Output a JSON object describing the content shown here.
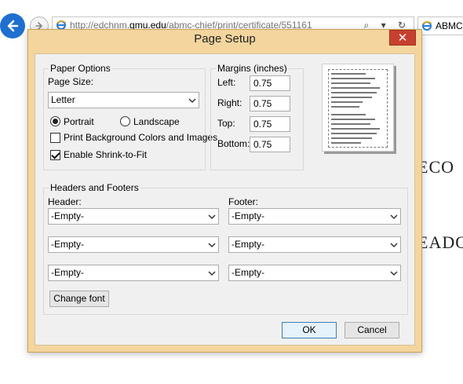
{
  "browser": {
    "url_prefix": "http://edchnm.",
    "url_host": "gmu.edu",
    "url_path": "/abmc-chief/print/certificate/551161",
    "address_actions": "⌕ ▾ ↻",
    "tab_title": "ABMC",
    "page_text_1": "ECO",
    "page_text_2": "EADO"
  },
  "dialog": {
    "title": "Page Setup",
    "close_glyph": "✕",
    "paper_options": {
      "legend": "Paper Options",
      "page_size_label": "Page Size:",
      "page_size_value": "Letter",
      "portrait_label": "Portrait",
      "landscape_label": "Landscape",
      "orientation": "Portrait",
      "print_background_label": "Print Background Colors and Images",
      "print_background_checked": false,
      "shrink_label": "Enable Shrink-to-Fit",
      "shrink_checked": true
    },
    "margins": {
      "legend": "Margins (inches)",
      "left_label": "Left:",
      "left_value": "0.75",
      "right_label": "Right:",
      "right_value": "0.75",
      "top_label": "Top:",
      "top_value": "0.75",
      "bottom_label": "Bottom:",
      "bottom_value": "0.75"
    },
    "headers_footers": {
      "legend": "Headers and Footers",
      "header_label": "Header:",
      "footer_label": "Footer:",
      "header_values": [
        "-Empty-",
        "-Empty-",
        "-Empty-"
      ],
      "footer_values": [
        "-Empty-",
        "-Empty-",
        "-Empty-"
      ],
      "change_font_label": "Change font"
    },
    "ok_label": "OK",
    "cancel_label": "Cancel"
  },
  "colors": {
    "dialog_frame": "#f4d59e",
    "close_button": "#c7402f",
    "back_button": "#1e6fd0"
  }
}
